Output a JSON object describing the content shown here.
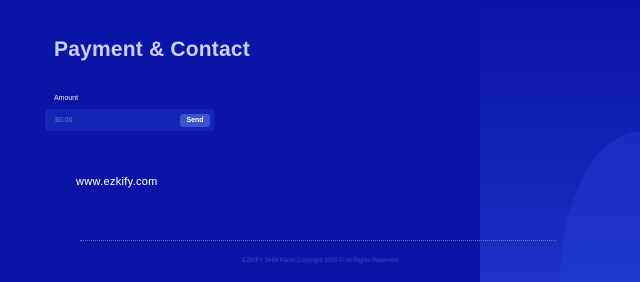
{
  "page": {
    "title": "Payment & Contact"
  },
  "payment": {
    "amount_label": "Amount",
    "amount_placeholder": "$0.00",
    "send_label": "Send"
  },
  "contact": {
    "website": "www.ezkify.com"
  },
  "footer": {
    "copyright": "EZKIFY SHM Panel Copyright 2025 © All Rights Reserved"
  },
  "colors": {
    "background": "#0a14a5",
    "accent": "#3e52d6"
  }
}
